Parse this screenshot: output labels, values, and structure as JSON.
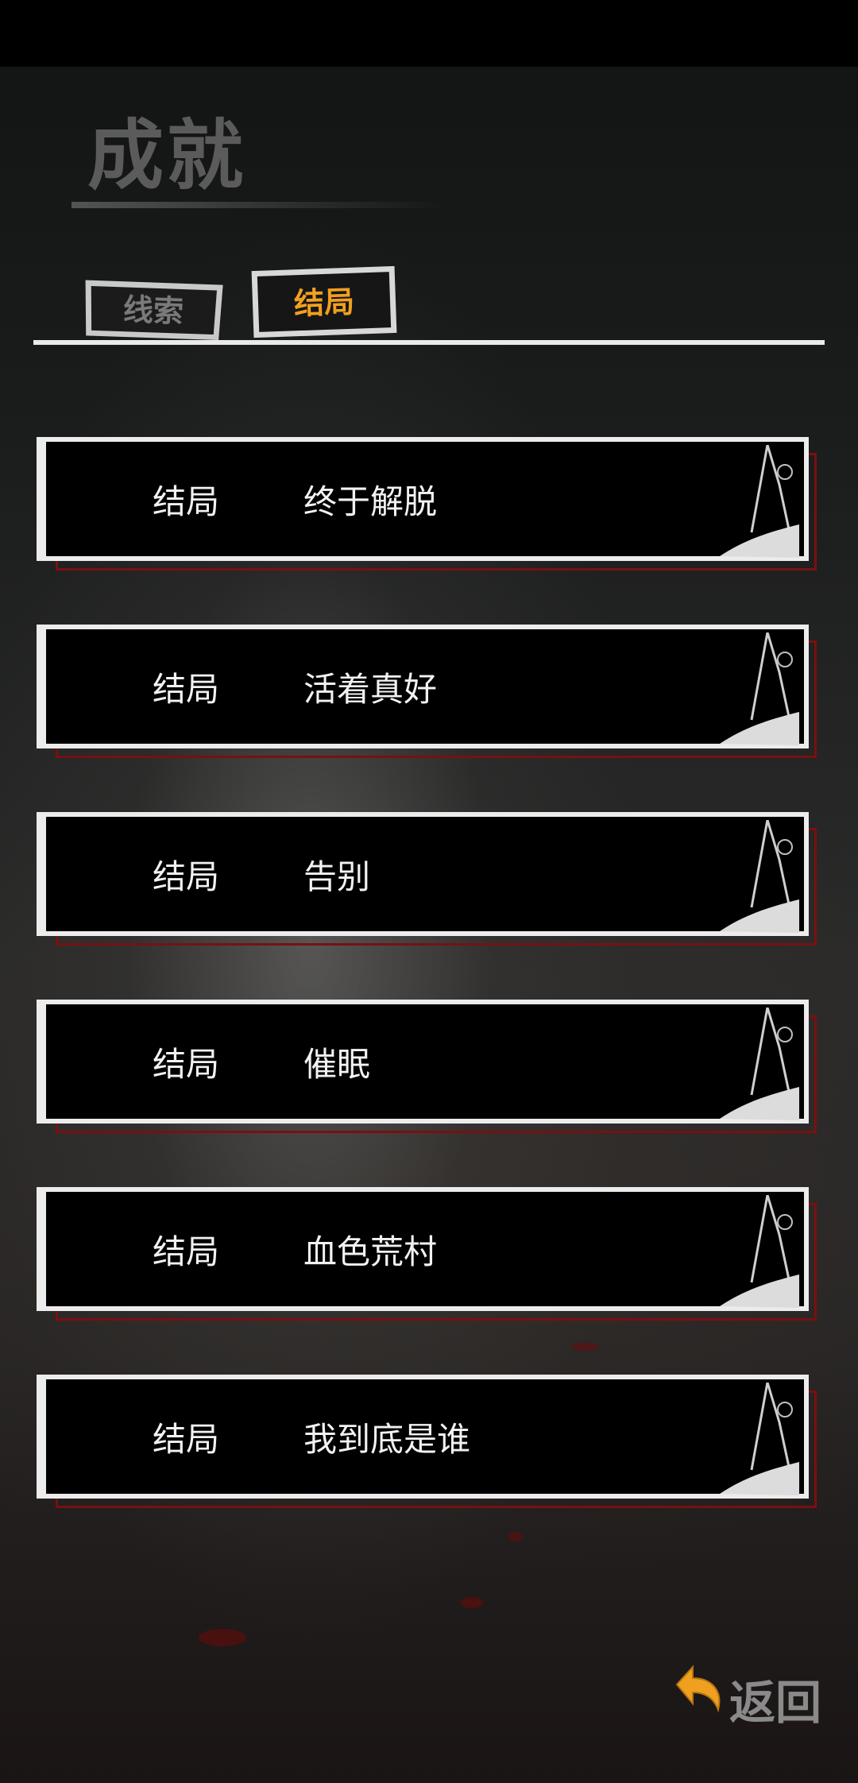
{
  "header": {
    "title": "成就"
  },
  "tabs": [
    {
      "label": "线索",
      "active": false
    },
    {
      "label": "结局",
      "active": true
    }
  ],
  "endings": [
    {
      "type": "结局",
      "name": "终于解脱"
    },
    {
      "type": "结局",
      "name": "活着真好"
    },
    {
      "type": "结局",
      "name": "告别"
    },
    {
      "type": "结局",
      "name": "催眠"
    },
    {
      "type": "结局",
      "name": "血色荒村"
    },
    {
      "type": "结局",
      "name": "我到底是谁"
    }
  ],
  "footer": {
    "back_label": "返回",
    "back_icon": "return-arrow-icon"
  },
  "colors": {
    "accent": "#f0a020",
    "card_border": "#ececec",
    "card_shadow": "#7a1010"
  }
}
